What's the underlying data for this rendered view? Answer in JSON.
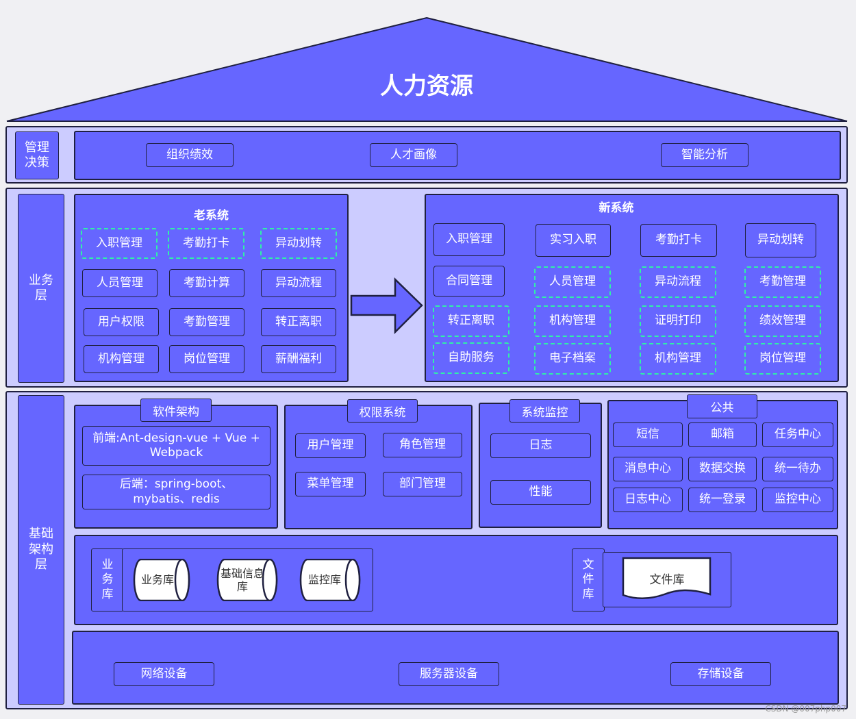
{
  "roof": {
    "title": "人力资源"
  },
  "management": {
    "label": "管理\n决策",
    "items": [
      "组织绩效",
      "人才画像",
      "智能分析"
    ]
  },
  "business": {
    "label": "业务\n层",
    "old_system": {
      "title": "老系统",
      "items": [
        "入职管理",
        "考勤打卡",
        "异动划转",
        "人员管理",
        "考勤计算",
        "异动流程",
        "用户权限",
        "考勤管理",
        "转正离职",
        "机构管理",
        "岗位管理",
        "薪酬福利"
      ]
    },
    "new_system": {
      "title": "新系统",
      "items": [
        "入职管理",
        "实习入职",
        "考勤打卡",
        "异动划转",
        "合同管理",
        "人员管理",
        "异动流程",
        "考勤管理",
        "转正离职",
        "机构管理",
        "证明打印",
        "绩效管理",
        "自助服务",
        "电子档案",
        "机构管理",
        "岗位管理"
      ]
    }
  },
  "infrastructure": {
    "label": "基础\n架构\n层",
    "software": {
      "title": "软件架构",
      "frontend": "前端:Ant-design-vue + Vue + Webpack",
      "backend": "后端：spring-boot、mybatis、redis"
    },
    "permission": {
      "title": "权限系统",
      "items": [
        "用户管理",
        "角色管理",
        "菜单管理",
        "部门管理"
      ]
    },
    "monitor": {
      "title": "系统监控",
      "items": [
        "日志",
        "性能"
      ]
    },
    "common": {
      "title": "公共",
      "items": [
        "短信",
        "邮箱",
        "任务中心",
        "消息中心",
        "数据交换",
        "统一待办",
        "日志中心",
        "统一登录",
        "监控中心"
      ]
    },
    "database": {
      "label": "业\n务\n库",
      "items": [
        "业务库",
        "基础信息\n库",
        "监控库"
      ]
    },
    "filestore": {
      "label": "文\n件\n库",
      "item": "文件库"
    },
    "hardware": {
      "items": [
        "网络设备",
        "服务器设备",
        "存储设备"
      ]
    }
  },
  "watermark": "CSDN @007php007"
}
